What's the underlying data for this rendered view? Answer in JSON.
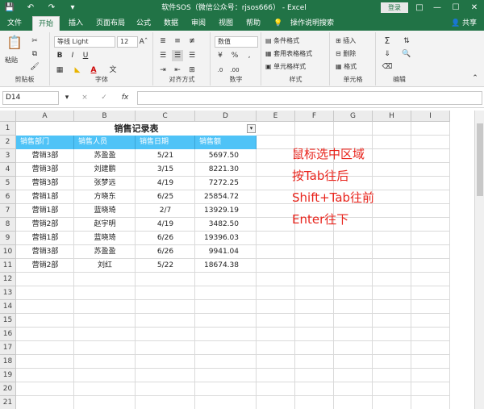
{
  "window": {
    "title": "软件SOS（微信公众号：rjsos666） - Excel",
    "login_label": "登录",
    "qa_icons": [
      "save-icon",
      "undo-icon",
      "redo-icon",
      "customize-icon"
    ],
    "controls": [
      "ribbon-options-icon",
      "minimize-icon",
      "maximize-icon",
      "close-icon"
    ]
  },
  "ribbon_tabs": [
    {
      "label": "文件"
    },
    {
      "label": "开始",
      "active": true
    },
    {
      "label": "插入"
    },
    {
      "label": "页面布局"
    },
    {
      "label": "公式"
    },
    {
      "label": "数据"
    },
    {
      "label": "审阅"
    },
    {
      "label": "视图"
    },
    {
      "label": "帮助"
    },
    {
      "label": "操作说明搜索"
    }
  ],
  "share_label": "共享",
  "ribbon": {
    "clipboard": {
      "label": "剪贴板",
      "paste": "粘贴"
    },
    "font": {
      "label": "字体",
      "name": "等线 Light",
      "size": "12",
      "bold": "B",
      "italic": "I",
      "underline": "U"
    },
    "alignment": {
      "label": "对齐方式"
    },
    "number": {
      "label": "数字",
      "format": "数值",
      "percent": "%"
    },
    "styles": {
      "label": "样式",
      "conditional": "条件格式",
      "table": "套用表格格式",
      "cell": "单元格样式"
    },
    "cells": {
      "label": "单元格",
      "insert": "插入",
      "delete": "删除",
      "format": "格式"
    },
    "editing": {
      "label": "编辑"
    }
  },
  "formula_bar": {
    "name_box": "D14",
    "fx": "fx",
    "cancel": "×",
    "enter": "✓",
    "value": ""
  },
  "sheet": {
    "columns": [
      "A",
      "B",
      "C",
      "D",
      "E",
      "F",
      "G",
      "H",
      "I"
    ],
    "rows": [
      "1",
      "2",
      "3",
      "4",
      "5",
      "6",
      "7",
      "8",
      "9",
      "10",
      "11",
      "12",
      "13",
      "14",
      "15",
      "16",
      "17",
      "18",
      "19",
      "20",
      "21"
    ],
    "title": "销售记录表",
    "headers": [
      "销售部门",
      "销售人员",
      "销售日期",
      "销售额"
    ],
    "records": [
      [
        "营销3部",
        "苏盈盈",
        "5/21",
        "5697.50"
      ],
      [
        "营销3部",
        "刘建鹏",
        "3/15",
        "8221.30"
      ],
      [
        "营销3部",
        "张梦远",
        "4/19",
        "7272.25"
      ],
      [
        "营销1部",
        "方晓东",
        "6/25",
        "25854.72"
      ],
      [
        "营销1部",
        "蓝晓琦",
        "2/7",
        "13929.19"
      ],
      [
        "营销2部",
        "赵宇明",
        "4/19",
        "3482.50"
      ],
      [
        "营销1部",
        "蓝晓琦",
        "6/26",
        "19396.03"
      ],
      [
        "营销3部",
        "苏盈盈",
        "6/26",
        "9941.04"
      ],
      [
        "营销2部",
        "刘红",
        "5/22",
        "18674.38"
      ]
    ]
  },
  "annotation": [
    "鼠标选中区域",
    "按Tab往后",
    "Shift+Tab往前",
    "Enter往下"
  ]
}
